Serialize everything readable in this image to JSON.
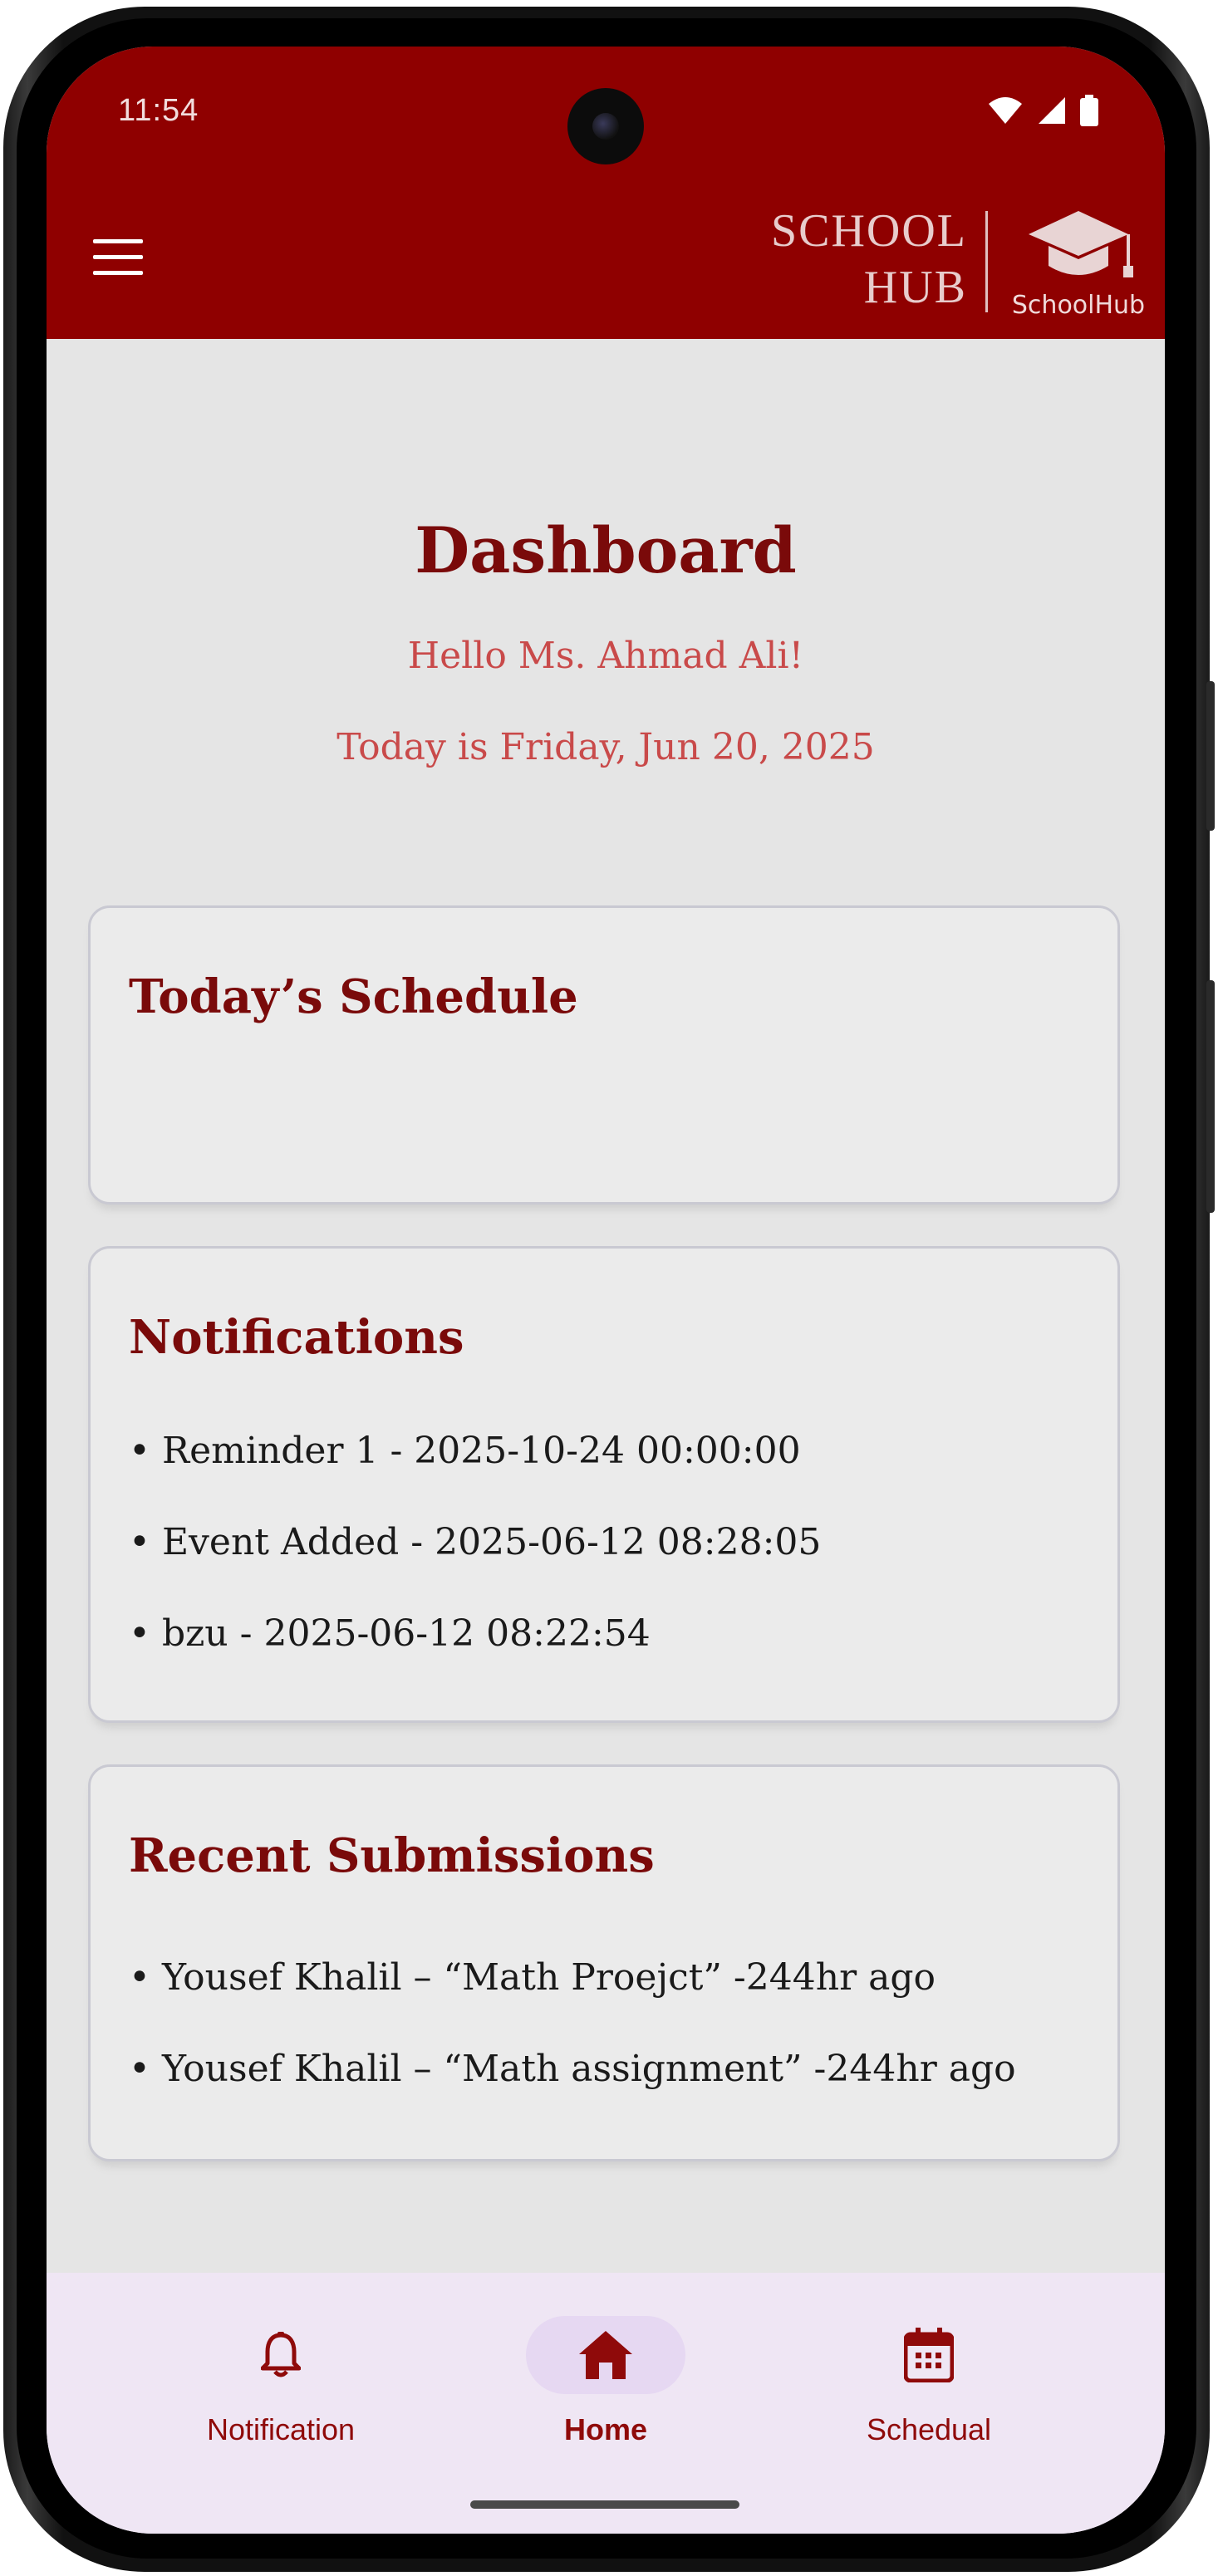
{
  "status_bar": {
    "time": "11:54",
    "icons": [
      "wifi-icon",
      "signal-icon",
      "battery-icon"
    ]
  },
  "app_bar": {
    "menu_icon": "menu-icon",
    "brand_line1": "SCHOOL",
    "brand_line2": "HUB",
    "logo_icon": "graduation-cap-icon",
    "logo_label": "SchoolHub",
    "background": "#8f0000"
  },
  "dashboard": {
    "title": "Dashboard",
    "greeting": "Hello Ms. Ahmad Ali!",
    "date_line": "Today is Friday, Jun 20, 2025"
  },
  "schedule_card": {
    "title": "Today’s Schedule"
  },
  "notifications_card": {
    "title": "Notifications",
    "items": [
      "• Reminder 1 - 2025-10-24 00:00:00",
      "• Event Added - 2025-06-12 08:28:05",
      "• bzu - 2025-06-12 08:22:54"
    ]
  },
  "submissions_card": {
    "title": "Recent Submissions",
    "items": [
      "• Yousef Khalil – “Math Proejct”  -244hr ago",
      "• Yousef Khalil – “Math assignment”  -244hr ago"
    ]
  },
  "bottom_nav": {
    "items": [
      {
        "label": "Notification",
        "icon": "bell-icon",
        "active": false
      },
      {
        "label": "Home",
        "icon": "home-icon",
        "active": true
      },
      {
        "label": "Schedual",
        "icon": "calendar-icon",
        "active": false
      }
    ]
  },
  "colors": {
    "accent": "#7a0a0a",
    "greeting": "#c94a4a",
    "nav_bg": "#efe6f4",
    "nav_active_pill": "#e6d8f2"
  }
}
